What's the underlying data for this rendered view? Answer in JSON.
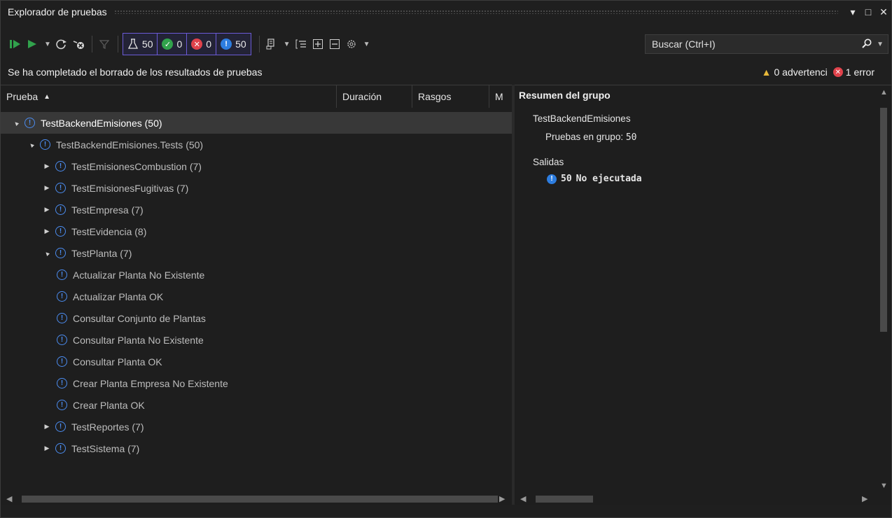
{
  "window": {
    "title": "Explorador de pruebas",
    "controls": [
      "▾",
      "□",
      "✕"
    ]
  },
  "toolbar": {
    "counters": [
      {
        "name": "total",
        "icon": "flask-icon",
        "value": "50"
      },
      {
        "name": "passed",
        "icon": "check-circle-icon",
        "value": "0"
      },
      {
        "name": "failed",
        "icon": "x-circle-icon",
        "value": "0"
      },
      {
        "name": "not-run",
        "icon": "info-circle-icon",
        "value": "50"
      }
    ],
    "search_placeholder": "Buscar (Ctrl+I)"
  },
  "status": {
    "message": "Se ha completado el borrado de los resultados de pruebas",
    "warnings": "0 advertenci",
    "errors": "1 error"
  },
  "columns": {
    "test": "Prueba",
    "duration": "Duración",
    "traits": "Rasgos",
    "m": "M"
  },
  "tree": [
    {
      "label": "TestBackendEmisiones (50)",
      "level": 0,
      "expander": "▲",
      "selected": true
    },
    {
      "label": "TestBackendEmisiones.Tests (50)",
      "level": 1,
      "expander": "▲"
    },
    {
      "label": "TestEmisionesCombustion (7)",
      "level": 2,
      "expander": "▶"
    },
    {
      "label": "TestEmisionesFugitivas (7)",
      "level": 2,
      "expander": "▶"
    },
    {
      "label": "TestEmpresa (7)",
      "level": 2,
      "expander": "▶"
    },
    {
      "label": "TestEvidencia (8)",
      "level": 2,
      "expander": "▶"
    },
    {
      "label": "TestPlanta (7)",
      "level": 2,
      "expander": "▲"
    },
    {
      "label": "Actualizar Planta No Existente",
      "level": 3,
      "expander": ""
    },
    {
      "label": "Actualizar Planta OK",
      "level": 3,
      "expander": ""
    },
    {
      "label": "Consultar Conjunto de Plantas",
      "level": 3,
      "expander": ""
    },
    {
      "label": "Consultar Planta No Existente",
      "level": 3,
      "expander": ""
    },
    {
      "label": "Consultar Planta OK",
      "level": 3,
      "expander": ""
    },
    {
      "label": "Crear Planta Empresa No Existente",
      "level": 3,
      "expander": ""
    },
    {
      "label": "Crear Planta OK",
      "level": 3,
      "expander": ""
    },
    {
      "label": "TestReportes (7)",
      "level": 2,
      "expander": "▶"
    },
    {
      "label": "TestSistema (7)",
      "level": 2,
      "expander": "▶"
    }
  ],
  "summary": {
    "title": "Resumen del grupo",
    "group_name": "TestBackendEmisiones",
    "tests_in_group_label": "Pruebas en grupo:",
    "tests_in_group_value": "50",
    "outputs_label": "Salidas",
    "not_run_count": "50",
    "not_run_label": "No ejecutada"
  },
  "colors": {
    "accent": "#6b5bd6",
    "pass": "#31a24c",
    "fail": "#e0424b",
    "info": "#2d7de0",
    "warning": "#e8b93a"
  }
}
